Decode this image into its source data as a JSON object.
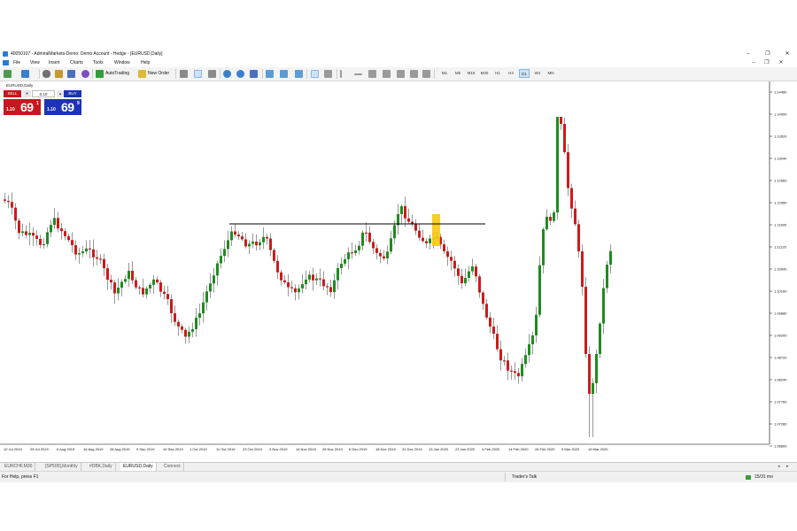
{
  "window": {
    "title": "40050107 - AdmiralMarkets-Demo: Demo Account - Hedge - [EURUSD,Daily]",
    "buttons": [
      "–",
      "❐",
      "✕"
    ]
  },
  "menu": {
    "items": [
      "File",
      "View",
      "Insert",
      "Charts",
      "Tools",
      "Window",
      "Help"
    ],
    "mdi_buttons": [
      "–",
      "❐",
      "✕"
    ]
  },
  "toolbar": {
    "autotrading_label": "AutoTrading",
    "new_order_label": "New Order",
    "timeframes": [
      "M1",
      "M5",
      "M15",
      "M30",
      "H1",
      "H4",
      "D1",
      "W1",
      "MN"
    ],
    "active_timeframe": "D1"
  },
  "chart": {
    "label": "EURUSD,Daily",
    "one_click": {
      "sell_label": "SELL",
      "buy_label": "BUY",
      "lot_value": "0.10",
      "sell_small": "1.10",
      "sell_big": "69",
      "sell_sup": "1",
      "buy_small": "1.10",
      "buy_big": "69",
      "buy_sup": "9"
    },
    "colors": {
      "bull": "#1e8c1e",
      "bear": "#cc1b1b",
      "highlight": "#f7c600",
      "hline": "#000000"
    },
    "price_axis": [
      "1.14480",
      "1.14000",
      "1.13520",
      "1.13040",
      "1.12560",
      "1.12080",
      "1.11600",
      "1.11120",
      "1.10640",
      "1.10160",
      "1.09680",
      "1.09200",
      "1.08720",
      "1.08240",
      "1.07760",
      "1.07280",
      "1.06800"
    ],
    "time_axis": [
      "10 Jul 2019",
      "25 Jul 2019",
      "6 Aug 2019",
      "16 Aug 2019",
      "28 Aug 2019",
      "9 Sep 2019",
      "19 Sep 2019",
      "1 Oct 2019",
      "11 Oct 2019",
      "23 Oct 2019",
      "4 Nov 2019",
      "14 Nov 2019",
      "26 Nov 2019",
      "6 Dec 2019",
      "18 Dec 2019",
      "31 Dec 2019",
      "13 Jan 2020",
      "23 Jan 2020",
      "4 Feb 2020",
      "14 Feb 2020",
      "26 Feb 2020",
      "9 Mar 2020",
      "19 Mar 2020"
    ]
  },
  "tabs": [
    "EURCHF,M30",
    "[SP500],Monthly",
    "#DBK,Daily",
    "EURUSD,Daily",
    "Connect"
  ],
  "active_tab": "EURUSD,Daily",
  "status": {
    "help": "For Help, press F1",
    "profile": "Trader's Talk",
    "size": "15/31 mo"
  }
}
